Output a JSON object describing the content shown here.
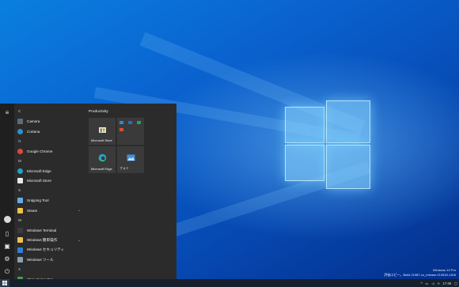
{
  "start_menu": {
    "rail": [
      "hamburger-icon",
      "avatar",
      "document-icon",
      "picture-icon",
      "gear-icon",
      "power-icon"
    ],
    "apps": [
      {
        "type": "letter",
        "label": "C"
      },
      {
        "type": "app",
        "label": "Camera",
        "icon": "camera-icon",
        "color": "#5b6b7a"
      },
      {
        "type": "app",
        "label": "Cortana",
        "icon": "cortana-icon",
        "color": "#2b8fd6"
      },
      {
        "type": "letter",
        "label": "G"
      },
      {
        "type": "app",
        "label": "Google Chrome",
        "icon": "chrome-icon",
        "color": "#e0463a"
      },
      {
        "type": "letter",
        "label": "M"
      },
      {
        "type": "app",
        "label": "Microsoft Edge",
        "icon": "edge-icon",
        "color": "#1fa3c8"
      },
      {
        "type": "app",
        "label": "Microsoft Store",
        "icon": "store-icon",
        "color": "#e9e9e9"
      },
      {
        "type": "letter",
        "label": "S"
      },
      {
        "type": "app",
        "label": "Snipping Tool",
        "icon": "scissors-icon",
        "color": "#6aa9e6"
      },
      {
        "type": "app",
        "label": "Steam",
        "icon": "folder-icon",
        "color": "#f2c14e",
        "expand": true
      },
      {
        "type": "letter",
        "label": "W"
      },
      {
        "type": "app",
        "label": "Windows Terminal",
        "icon": "terminal-icon",
        "color": "#3b3b3b"
      },
      {
        "type": "app",
        "label": "Windows 簡単操作",
        "icon": "folder-icon",
        "color": "#f2c14e",
        "expand": true
      },
      {
        "type": "app",
        "label": "Windows セキュリティ",
        "icon": "shield-icon",
        "color": "#2f7fd6"
      },
      {
        "type": "app",
        "label": "Windows ツール",
        "icon": "gear-icon",
        "color": "#8aa2b5"
      },
      {
        "type": "letter",
        "label": "X"
      },
      {
        "type": "app",
        "label": "Xbox Game Bar",
        "icon": "xbox-icon",
        "color": "#43a047"
      }
    ],
    "tiles": {
      "group_title": "Productivity",
      "items": [
        {
          "label": "Microsoft Store",
          "icon": "store-icon"
        },
        {
          "label": "",
          "icon": "mixed-apps-icon"
        },
        {
          "label": "Microsoft Edge",
          "icon": "edge-icon"
        },
        {
          "label": "フォト",
          "icon": "photos-icon"
        }
      ]
    }
  },
  "watermark": {
    "line1": "Windows 10 Pro",
    "line2": "評価コピー。Build 21387.co_release.210518-1406"
  },
  "tray": {
    "chevron": "^",
    "ime": "A",
    "time": "17:46"
  }
}
